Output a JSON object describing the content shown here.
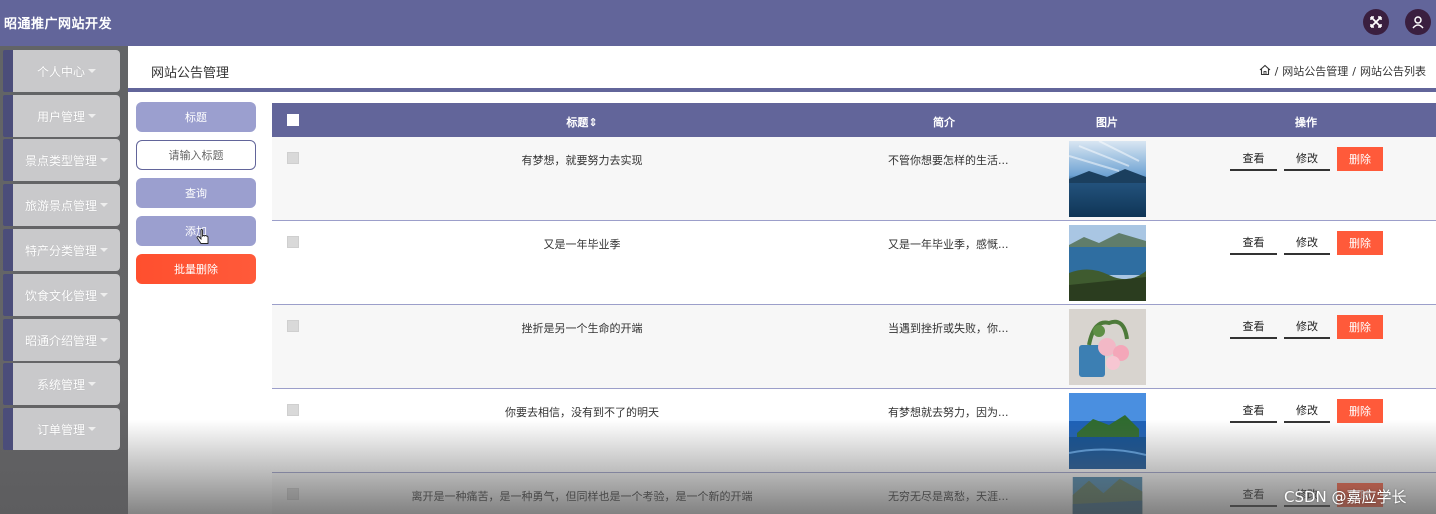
{
  "app": {
    "title": "昭通推广网站开发"
  },
  "topbar": {
    "icons": [
      "fullscreen-icon",
      "user-icon"
    ]
  },
  "sidebar": {
    "items": [
      {
        "label": "个人中心"
      },
      {
        "label": "用户管理"
      },
      {
        "label": "景点类型管理"
      },
      {
        "label": "旅游景点管理"
      },
      {
        "label": "特产分类管理"
      },
      {
        "label": "饮食文化管理"
      },
      {
        "label": "昭通介绍管理"
      },
      {
        "label": "系统管理"
      },
      {
        "label": "订单管理"
      }
    ]
  },
  "header": {
    "page_title": "网站公告管理",
    "breadcrumb": [
      "网站公告管理",
      "网站公告列表"
    ],
    "breadcrumb_sep": "/"
  },
  "controls": {
    "field_label": "标题",
    "search_placeholder": "请输入标题",
    "query_button": "查询",
    "add_button": "添加",
    "batch_delete_button": "批量删除"
  },
  "table": {
    "columns": {
      "title": "标题",
      "sort_icon": "⇕",
      "summary": "简介",
      "image": "图片",
      "actions": "操作"
    },
    "rows": [
      {
        "title": "有梦想，就要努力去实现",
        "summary": "不管你想要怎样的生活...",
        "image": "sky-lake"
      },
      {
        "title": "又是一年毕业季",
        "summary": "又是一年毕业季，感慨...",
        "image": "island-lake"
      },
      {
        "title": "挫折是另一个生命的开端",
        "summary": "当遇到挫折或失败，你...",
        "image": "flower-pot"
      },
      {
        "title": "你要去相信，没有到不了的明天",
        "summary": "有梦想就去努力，因为...",
        "image": "blue-island"
      },
      {
        "title": "离开是一种痛苦，是一种勇气，但同样也是一个考验，是一个新的开端",
        "summary": "无穷无尽是离愁，天涯...",
        "image": "mountain-lake"
      }
    ],
    "action_labels": {
      "view": "查看",
      "edit": "修改",
      "delete": "删除"
    }
  },
  "watermark": "CSDN @嘉应学长",
  "colors": {
    "primary": "#62659a",
    "danger": "#ff5a3a",
    "button_light": "#9b9fcf"
  }
}
